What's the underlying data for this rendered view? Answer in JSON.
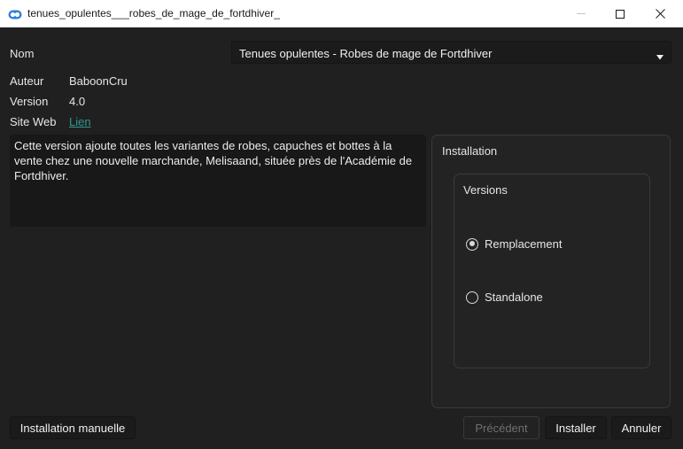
{
  "window": {
    "title": "tenues_opulentes___robes_de_mage_de_fortdhiver_",
    "icon": "mod-organizer-icon",
    "accent": "#3a8ee6"
  },
  "fields": {
    "name_label": "Nom",
    "name_value": "Tenues opulentes - Robes de mage de Fortdhiver",
    "author_label": "Auteur",
    "author_value": "BaboonCru",
    "version_label": "Version",
    "version_value": "4.0",
    "website_label": "Site Web",
    "website_link": "Lien"
  },
  "description": "Cette version ajoute toutes les variantes de robes, capuches et bottes à la vente chez une nouvelle marchande, Melisaand, située près de l'Académie de Fortdhiver.",
  "installation": {
    "title": "Installation",
    "versions": {
      "title": "Versions",
      "options": [
        {
          "label": "Remplacement",
          "checked": true
        },
        {
          "label": "Standalone",
          "checked": false
        }
      ]
    }
  },
  "buttons": {
    "manual": "Installation manuelle",
    "previous": "Précédent",
    "install": "Installer",
    "cancel": "Annuler"
  }
}
